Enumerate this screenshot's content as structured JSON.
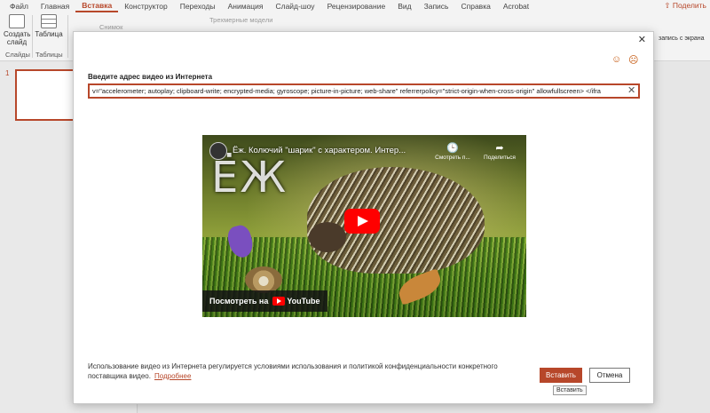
{
  "ribbon": {
    "tabs": [
      "Файл",
      "Главная",
      "Вставка",
      "Конструктор",
      "Переходы",
      "Анимация",
      "Слайд-шоу",
      "Рецензирование",
      "Вид",
      "Запись",
      "Справка",
      "Acrobat"
    ],
    "active_tab": "Вставка",
    "share": "Поделить",
    "new_slide": "Создать слайд",
    "table": "Таблица",
    "screenshot": "Снимок",
    "models_3d": "Трехмерные модели",
    "group_slides": "Слайды",
    "group_tables": "Таблицы",
    "record_label": "запись с экрана"
  },
  "slides_panel": {
    "slide_number": "1"
  },
  "dialog": {
    "field_label": "Введите адрес видео из Интернета",
    "url_value": "v=\"accelerometer; autoplay; clipboard-write; encrypted-media; gyroscope; picture-in-picture; web-share\" referrerpolicy=\"strict-origin-when-cross-origin\" allowfullscreen> </ifra",
    "video": {
      "title": "Ёж. Колючий \"шарик\" с характером. Интер...",
      "big_title": "ЁЖ",
      "watch_later": "Смотреть п...",
      "share": "Поделиться",
      "watch_on": "Посмотреть на",
      "youtube": "YouTube"
    },
    "terms_text": "Использование видео из Интернета регулируется условиями использования и политикой конфиденциальности конкретного поставщика видео.",
    "terms_link": "Подробнее",
    "insert_button": "Вставить",
    "cancel_button": "Отмена",
    "tooltip": "Вставить"
  }
}
